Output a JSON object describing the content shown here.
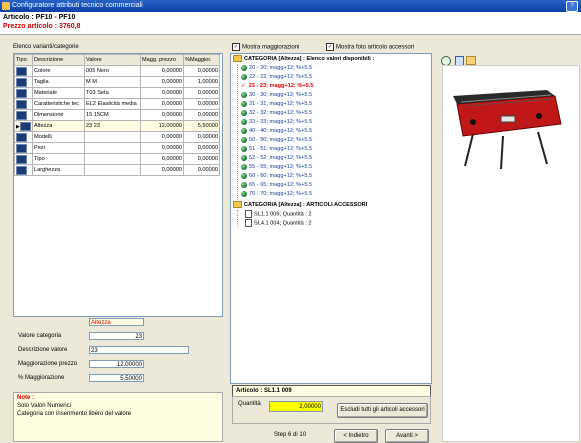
{
  "window": {
    "title": "Configuratore attributi tecnico commerciali",
    "help_label": "?"
  },
  "header": {
    "article": "Articolo : PF10 - PF10",
    "price": "Prezzo articolo : 3760,8"
  },
  "left": {
    "section_title": "Elenco varianti/categorie",
    "columns": [
      "Tipo",
      "Descrizione",
      "Valore",
      "Magg. prezzo",
      "%Maggior."
    ],
    "rows": [
      {
        "desc": "Colore",
        "value": "005 Nero",
        "magg": "0,00000",
        "perc": "0,00000"
      },
      {
        "desc": "Taglia",
        "value": "M M",
        "magg": "0,00000",
        "perc": "1,00000"
      },
      {
        "desc": "Materiale",
        "value": "T03 Seta",
        "magg": "0,00000",
        "perc": "0,00000"
      },
      {
        "desc": "Caratteristiche tec",
        "value": "EL2 Elasticità media",
        "magg": "0,00000",
        "perc": "0,00000"
      },
      {
        "desc": "Dimensione",
        "value": "15 15CM",
        "magg": "0,00000",
        "perc": "0,00000"
      },
      {
        "desc": "Altezza",
        "value": "23 23",
        "magg": "12,00000",
        "perc": "5,50000"
      },
      {
        "desc": "Modelli",
        "value": "",
        "magg": "0,00000",
        "perc": "0,00000"
      },
      {
        "desc": "Pesi",
        "value": "",
        "magg": "0,00000",
        "perc": "0,00000"
      },
      {
        "desc": "Tipo",
        "value": "",
        "magg": "0,00000",
        "perc": "0,00000"
      },
      {
        "desc": "Larghezza",
        "value": "",
        "magg": "0,00000",
        "perc": "0,00000"
      }
    ],
    "selected_row_marker": "▶"
  },
  "form": {
    "category_name": "Altezza",
    "valore_categoria_label": "Valore categoria",
    "valore_categoria": "23",
    "descrizione_valore_label": "Descrizione valore",
    "descrizione_valore": "23",
    "magg_prezzo_label": "Maggiorazione prezzo",
    "magg_prezzo": "12,00000",
    "perc_magg_label": "% Maggiorazione",
    "perc_magg": "5,50000"
  },
  "notes": {
    "title": "Note :",
    "line1": "Solo Valori Numerici",
    "line2": "Categoria con inserimento libero del valore"
  },
  "checkboxes": {
    "mostra_magg": "Mostra maggiorazioni",
    "mostra_foto": "Mostra foto articolo accessori",
    "check_mark": "✓"
  },
  "tree": {
    "root": "CATEGORIA [Altezza] : Elenco valori disponibili :",
    "values": [
      {
        "text": "20 - 20; magg+12; %+5.5",
        "selected": false
      },
      {
        "text": "22 - 22; magg+12; %+5.5",
        "selected": false
      },
      {
        "text": "23 - 23; magg+12; %+5.5",
        "selected": true
      },
      {
        "text": "30 - 30; magg+12; %+5.5",
        "selected": false
      },
      {
        "text": "31 - 31; magg+12; %+5.5",
        "selected": false
      },
      {
        "text": "32 - 32; magg+12; %+5.5",
        "selected": false
      },
      {
        "text": "33 - 33; magg+12; %+5.5",
        "selected": false
      },
      {
        "text": "40 - 40; magg+12; %+5.5",
        "selected": false
      },
      {
        "text": "50 - 50; magg+12; %+5.5",
        "selected": false
      },
      {
        "text": "51 - 51; magg+12; %+5.5",
        "selected": false
      },
      {
        "text": "52 - 52; magg+12; %+5.5",
        "selected": false
      },
      {
        "text": "55 - 55; magg+12; %+5.5",
        "selected": false
      },
      {
        "text": "60 - 60; magg+12; %+5.5",
        "selected": false
      },
      {
        "text": "65 - 65; magg+12; %+5.5",
        "selected": false
      },
      {
        "text": "70 - 70; magg+12; %+5.5",
        "selected": false
      }
    ],
    "selected_marker": "✓",
    "accessori_root": "CATEGORIA [Altezza] : ARTICOLI ACCESSORI",
    "accessori": [
      "SL1.1 009; Quantità : 2",
      "SL4.1 004; Quantità : 2"
    ]
  },
  "article_panel": {
    "article": "Articolo : SL1.1 009",
    "qty_label": "Quantità",
    "qty_value": "2,00000",
    "exclude_button": "Escludi tutti gli articoli accessori"
  },
  "nav": {
    "step": "Step 6 di 10",
    "back": "< Indietro",
    "next": "Avanti >"
  },
  "colors": {
    "title_bar": "#0a3fa8",
    "price_red": "#d00000",
    "tree_blue": "#1a3fa0",
    "selected_red": "#e00000",
    "qty_highlight": "#ffff00"
  }
}
